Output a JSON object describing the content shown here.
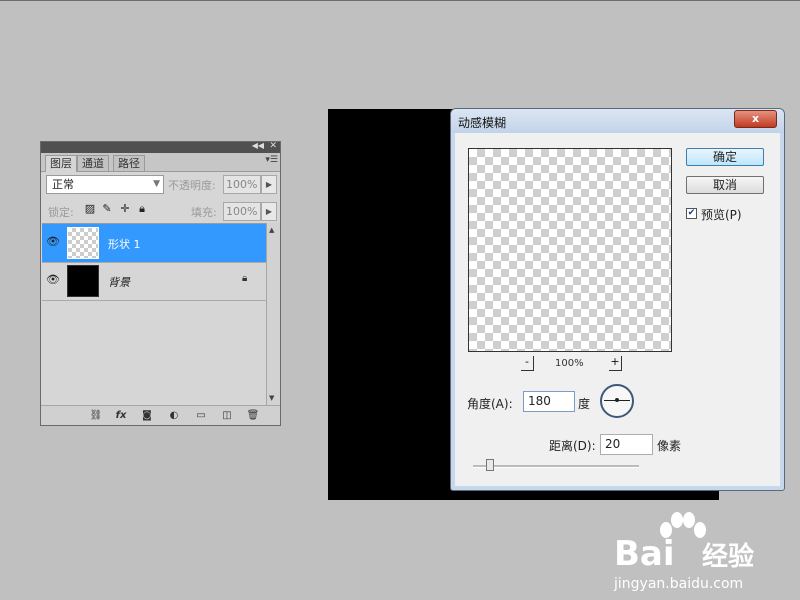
{
  "layers_panel": {
    "tabs": [
      "图层",
      "通道",
      "路径"
    ],
    "blend_mode": "正常",
    "opacity_label": "不透明度:",
    "opacity_value": "100%",
    "lock_label": "锁定:",
    "fill_label": "填充:",
    "fill_value": "100%",
    "layers": [
      {
        "name": "形状 1",
        "selected": true,
        "thumbnail": "transparent-checker",
        "visible": true
      },
      {
        "name": "背景",
        "selected": false,
        "thumbnail": "black-fill",
        "visible": true,
        "locked": true
      }
    ],
    "footer_icons": [
      "link-icon",
      "fx-icon",
      "mask-icon",
      "adjustment-icon",
      "group-folder-icon",
      "new-layer-icon",
      "trash-icon"
    ],
    "selection_color": "#3399ff"
  },
  "dialog": {
    "title": "动感模糊",
    "close_glyph": "x",
    "ok_label": "确定",
    "cancel_label": "取消",
    "preview_label": "预览(P)",
    "preview_checked": true,
    "zoom_value": "100%",
    "zoom_out_glyph": "-",
    "zoom_in_glyph": "+",
    "angle_label": "角度(A):",
    "angle_value": "180",
    "angle_unit": "度",
    "distance_label": "距离(D):",
    "distance_value": "20",
    "distance_unit": "像素",
    "distance_slider_fraction": 0.1
  },
  "watermark": {
    "brand": "Bai",
    "brand_2": "经验",
    "url": "jingyan.baidu.com"
  }
}
